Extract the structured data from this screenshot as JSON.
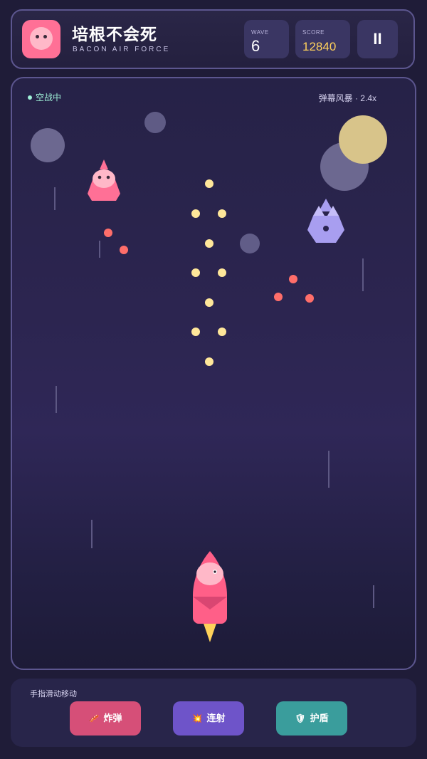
{
  "header": {
    "title": "培根不会死",
    "subtitle": "BACON AIR FORCE",
    "wave_label": "WAVE",
    "wave_value": "6",
    "score_label": "SCORE",
    "score_value": "12840",
    "pause_glyph": "II"
  },
  "arena": {
    "status": "空战中",
    "danmaku": "弹幕风暴 · 2.4x"
  },
  "controls": {
    "hint": "手指滑动移动",
    "bomb_icon": "🥓",
    "bomb_label": "炸弹",
    "rapid_icon": "💥",
    "rapid_label": "连射",
    "shield_icon": "🛡",
    "shield_label": "护盾"
  },
  "colors": {
    "accent_pink": "#ff7096",
    "score_gold": "#ffd15c",
    "status_green": "#9ff0d8",
    "bomb_button": "#d64f78",
    "rapid_button": "#6e54c9",
    "shield_button": "#3a9d9c"
  }
}
